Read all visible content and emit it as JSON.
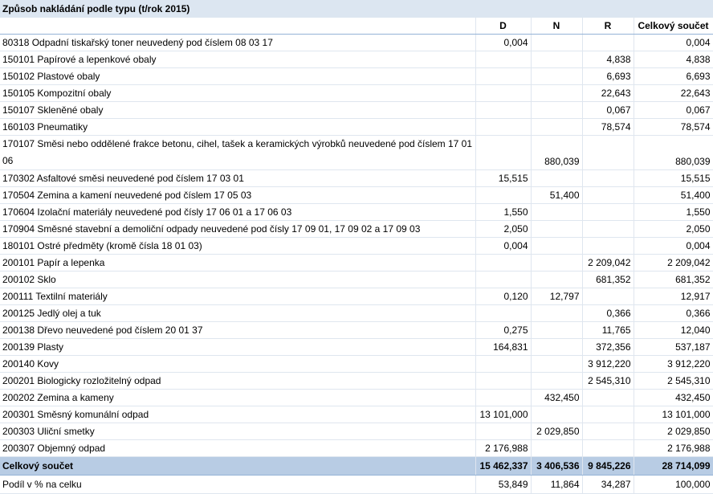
{
  "title": "Způsob nakládání podle typu (t/rok 2015)",
  "columns": [
    "D",
    "N",
    "R",
    "Celkový součet"
  ],
  "rows": [
    {
      "label": "80318 Odpadní tiskařský toner neuvedený pod číslem 08 03 17",
      "d": "0,004",
      "n": "",
      "r": "",
      "total": "0,004"
    },
    {
      "label": "150101 Papírové a lepenkové obaly",
      "d": "",
      "n": "",
      "r": "4,838",
      "total": "4,838"
    },
    {
      "label": "150102 Plastové obaly",
      "d": "",
      "n": "",
      "r": "6,693",
      "total": "6,693"
    },
    {
      "label": "150105 Kompozitní obaly",
      "d": "",
      "n": "",
      "r": "22,643",
      "total": "22,643"
    },
    {
      "label": "150107 Skleněné obaly",
      "d": "",
      "n": "",
      "r": "0,067",
      "total": "0,067"
    },
    {
      "label": "160103 Pneumatiky",
      "d": "",
      "n": "",
      "r": "78,574",
      "total": "78,574"
    },
    {
      "label": "170107 Směsi nebo oddělené frakce betonu, cihel, tašek a keramických výrobků neuvedené pod číslem 17 01 06",
      "d": "",
      "n": "880,039",
      "r": "",
      "total": "880,039"
    },
    {
      "label": "170302 Asfaltové směsi neuvedené pod číslem 17 03 01",
      "d": "15,515",
      "n": "",
      "r": "",
      "total": "15,515"
    },
    {
      "label": "170504 Zemina a kamení neuvedené pod číslem 17 05 03",
      "d": "",
      "n": "51,400",
      "r": "",
      "total": "51,400"
    },
    {
      "label": "170604 Izolační materiály neuvedené pod čísly 17 06 01 a 17 06 03",
      "d": "1,550",
      "n": "",
      "r": "",
      "total": "1,550"
    },
    {
      "label": "170904 Směsné stavební a demoliční odpady neuvedené pod čísly 17 09 01, 17 09 02 a 17 09 03",
      "d": "2,050",
      "n": "",
      "r": "",
      "total": "2,050"
    },
    {
      "label": "180101 Ostré předměty (kromě čísla 18 01 03)",
      "d": "0,004",
      "n": "",
      "r": "",
      "total": "0,004"
    },
    {
      "label": "200101 Papír a lepenka",
      "d": "",
      "n": "",
      "r": "2 209,042",
      "total": "2 209,042"
    },
    {
      "label": "200102 Sklo",
      "d": "",
      "n": "",
      "r": "681,352",
      "total": "681,352"
    },
    {
      "label": "200111 Textilní materiály",
      "d": "0,120",
      "n": "12,797",
      "r": "",
      "total": "12,917"
    },
    {
      "label": "200125 Jedlý olej a tuk",
      "d": "",
      "n": "",
      "r": "0,366",
      "total": "0,366"
    },
    {
      "label": "200138 Dřevo neuvedené pod číslem 20 01 37",
      "d": "0,275",
      "n": "",
      "r": "11,765",
      "total": "12,040"
    },
    {
      "label": "200139 Plasty",
      "d": "164,831",
      "n": "",
      "r": "372,356",
      "total": "537,187"
    },
    {
      "label": "200140 Kovy",
      "d": "",
      "n": "",
      "r": "3 912,220",
      "total": "3 912,220"
    },
    {
      "label": "200201 Biologicky rozložitelný odpad",
      "d": "",
      "n": "",
      "r": "2 545,310",
      "total": "2 545,310"
    },
    {
      "label": "200202 Zemina a kameny",
      "d": "",
      "n": "432,450",
      "r": "",
      "total": "432,450"
    },
    {
      "label": "200301 Směsný komunální odpad",
      "d": "13 101,000",
      "n": "",
      "r": "",
      "total": "13 101,000"
    },
    {
      "label": "200303 Uliční smetky",
      "d": "",
      "n": "2 029,850",
      "r": "",
      "total": "2 029,850"
    },
    {
      "label": "200307 Objemný odpad",
      "d": "2 176,988",
      "n": "",
      "r": "",
      "total": "2 176,988"
    }
  ],
  "grand_total": {
    "label": "Celkový součet",
    "d": "15 462,337",
    "n": "3 406,536",
    "r": "9 845,226",
    "total": "28 714,099"
  },
  "percent_row": {
    "label": "Podíl v % na celku",
    "d": "53,849",
    "n": "11,864",
    "r": "34,287",
    "total": "100,000"
  }
}
